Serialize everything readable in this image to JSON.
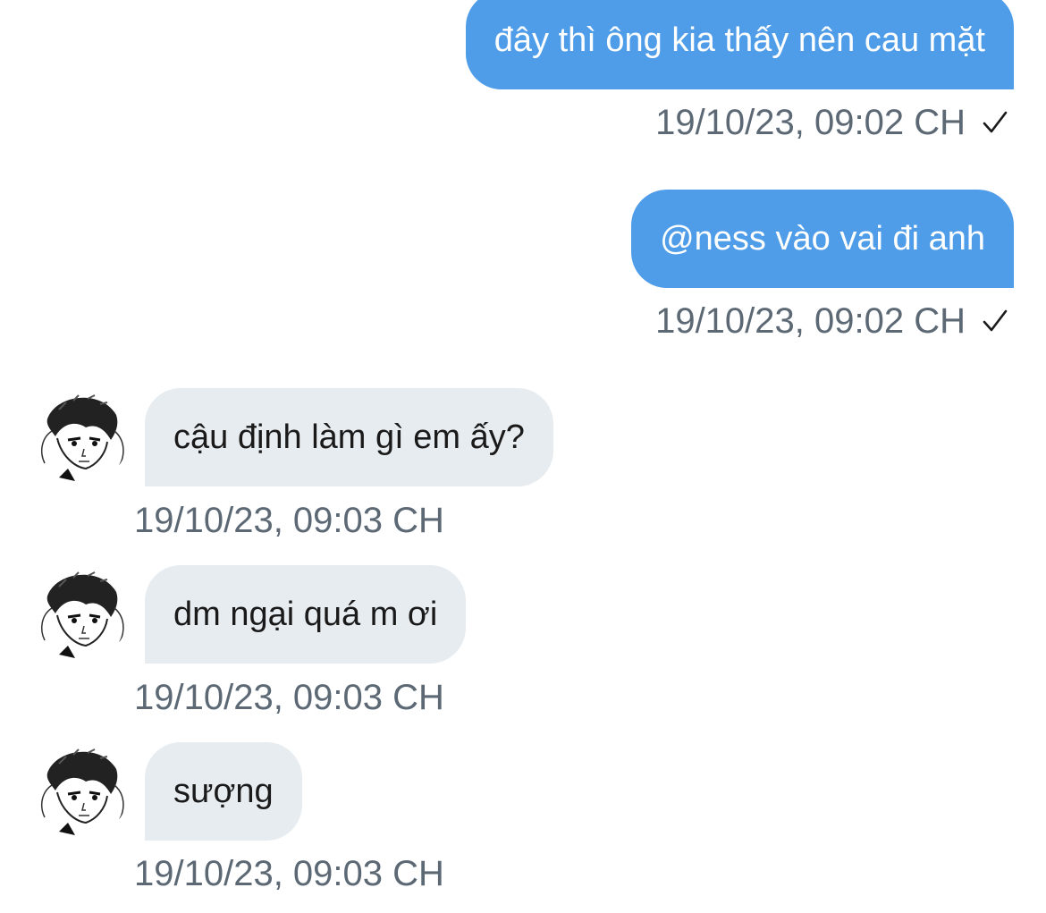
{
  "messages": [
    {
      "direction": "sent",
      "text": "đây thì ông kia thấy nên cau mặt",
      "time": "19/10/23, 09:02 CH",
      "status_icon": "check-icon"
    },
    {
      "direction": "sent",
      "text": "@ness vào vai đi anh",
      "time": "19/10/23, 09:02 CH",
      "status_icon": "check-icon"
    },
    {
      "direction": "received",
      "text": "cậu định làm gì em ấy?",
      "time": "19/10/23, 09:03 CH",
      "avatar": "manga-portrait-avatar"
    },
    {
      "direction": "received",
      "text": "dm ngại quá m ơi",
      "time": "19/10/23, 09:03 CH",
      "avatar": "manga-portrait-avatar"
    },
    {
      "direction": "received",
      "text": "sượng",
      "time": "19/10/23, 09:03 CH",
      "avatar": "manga-portrait-avatar"
    }
  ],
  "colors": {
    "sent_bubble": "#4f9de9",
    "received_bubble": "#e7ecf0",
    "timestamp": "#5c6975"
  }
}
